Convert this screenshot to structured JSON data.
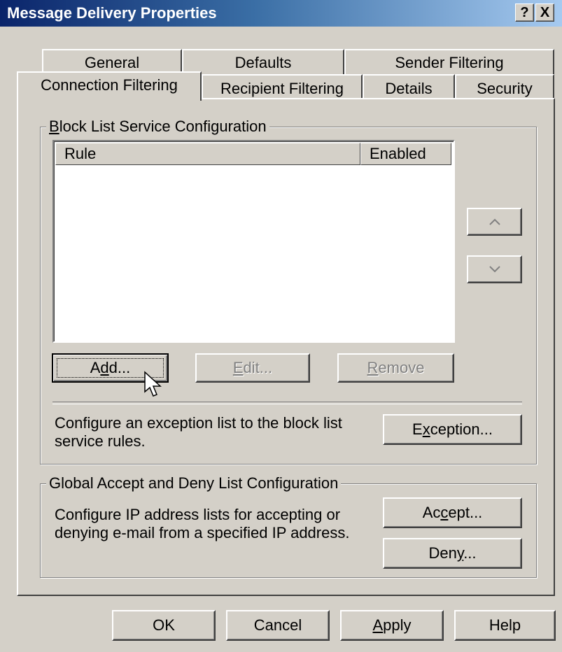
{
  "window": {
    "title": "Message Delivery Properties",
    "help_button": "?",
    "close_button": "X"
  },
  "tabs": {
    "row_back": [
      {
        "label": "General"
      },
      {
        "label": "Defaults"
      },
      {
        "label": "Sender Filtering"
      }
    ],
    "row_front": [
      {
        "label": "Connection Filtering",
        "selected": true
      },
      {
        "label": "Recipient Filtering"
      },
      {
        "label": "Details"
      },
      {
        "label": "Security"
      }
    ]
  },
  "block_list": {
    "group_title_first": "B",
    "group_title_rest": "lock List Service Configuration",
    "columns": {
      "rule": "Rule",
      "enabled": "Enabled"
    },
    "rows": [],
    "move_up_icon": "chevron-up-icon",
    "move_down_icon": "chevron-down-icon",
    "add": {
      "pre": "A",
      "u": "d",
      "post": "d..."
    },
    "edit": {
      "pre": "",
      "u": "E",
      "post": "dit..."
    },
    "remove": {
      "pre": "",
      "u": "R",
      "post": "emove"
    },
    "exception_text_line1": "Configure an exception list to the block list",
    "exception_text_line2": "service rules.",
    "exception": {
      "pre": "E",
      "u": "x",
      "post": "ception..."
    }
  },
  "global_list": {
    "group_title": "Global Accept and Deny List Configuration",
    "text_line1": "Configure IP address lists for accepting or",
    "text_line2": "denying e-mail from a specified IP address.",
    "accept": {
      "pre": "Ac",
      "u": "c",
      "post": "ept..."
    },
    "deny": {
      "pre": "Den",
      "u": "y",
      "post": "..."
    }
  },
  "footer": {
    "ok": "OK",
    "cancel": "Cancel",
    "apply": {
      "pre": "",
      "u": "A",
      "post": "pply"
    },
    "help": "Help"
  }
}
